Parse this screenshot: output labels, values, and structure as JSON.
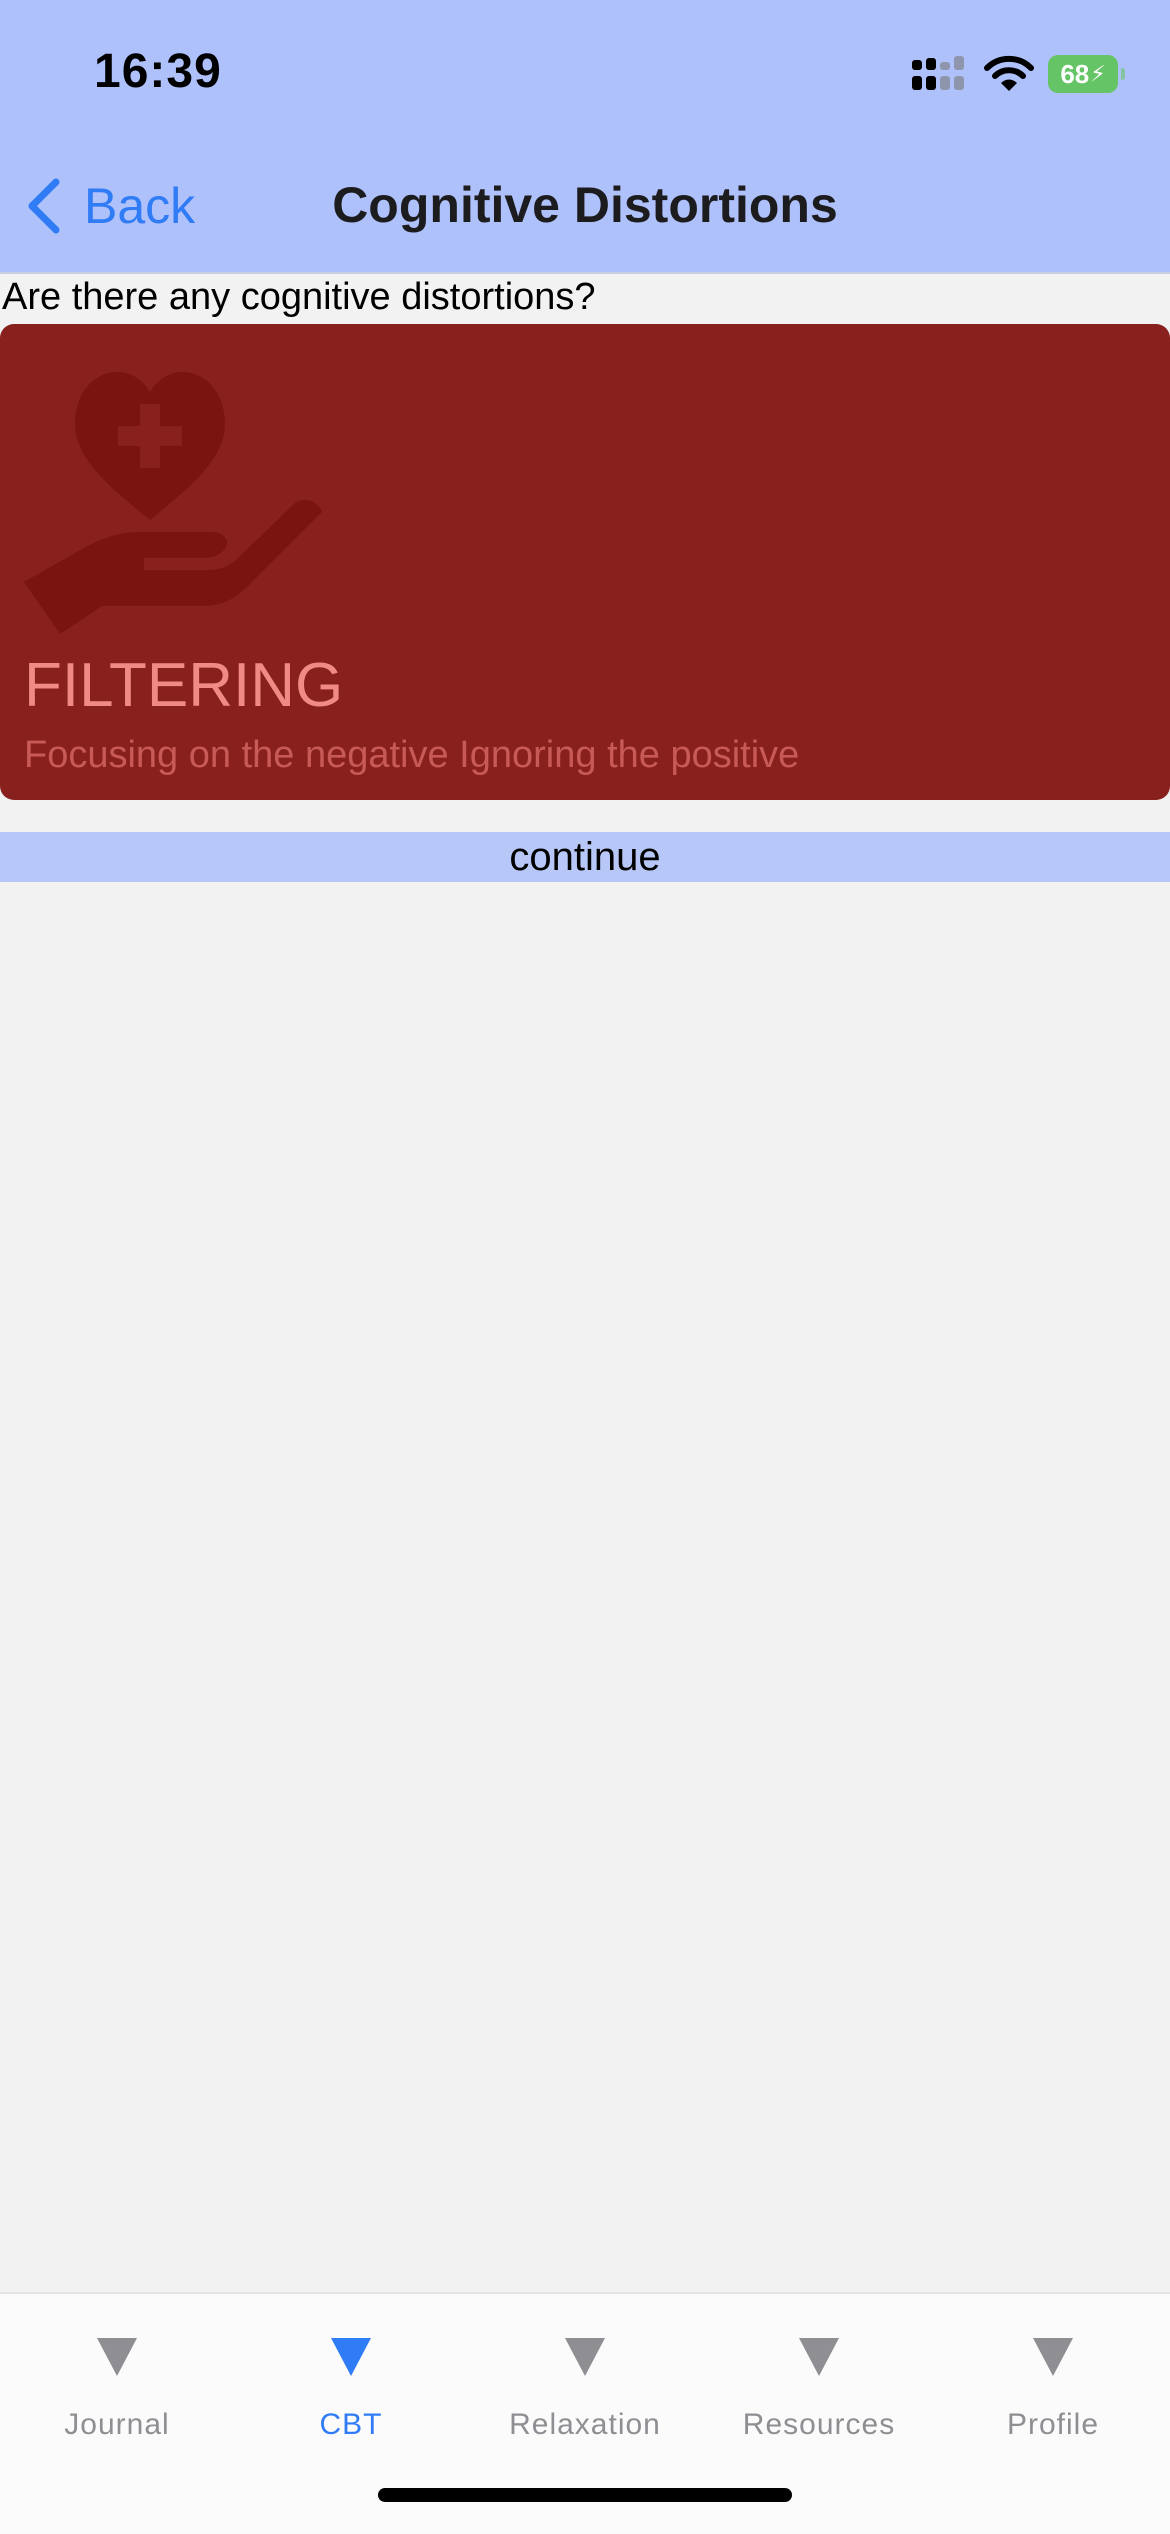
{
  "status_bar": {
    "time": "16:39",
    "battery": "68"
  },
  "nav": {
    "back_label": "Back",
    "title": "Cognitive Distortions"
  },
  "main": {
    "question": "Are there any cognitive distortions?",
    "card": {
      "title": "FILTERING",
      "subtitle": "Focusing on the negative Ignoring the positive",
      "icon": "heart-in-hand-icon"
    },
    "continue_label": "continue"
  },
  "tab_bar": {
    "active": "CBT",
    "tabs": [
      {
        "label": "Journal"
      },
      {
        "label": "CBT"
      },
      {
        "label": "Relaxation"
      },
      {
        "label": "Resources"
      },
      {
        "label": "Profile"
      }
    ]
  },
  "colors": {
    "nav_background": "#afc1fb",
    "accent": "#2f7cf6",
    "card_background": "#88201e",
    "card_title": "#f08a84",
    "battery": "#65c466",
    "page_background": "#f2f2f2"
  }
}
